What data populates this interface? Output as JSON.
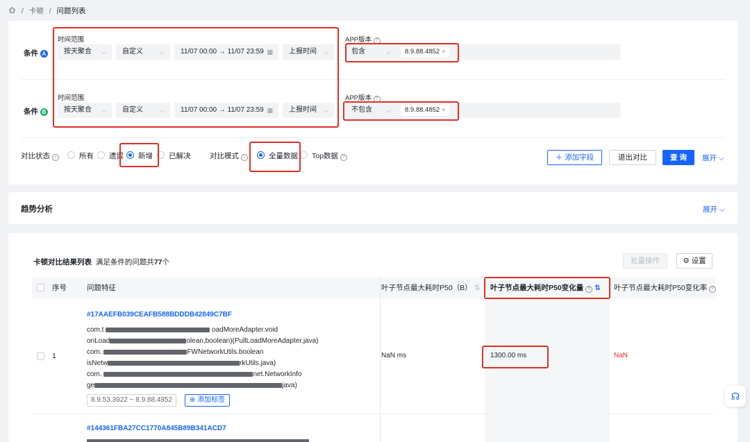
{
  "breadcrumb": {
    "items": [
      "卡顿",
      "问题列表"
    ]
  },
  "filter": {
    "condA": {
      "label": "条件",
      "badge": "A",
      "time_title": "时间范围",
      "agg": "按天聚合",
      "mode": "自定义",
      "range": "11/07 00:00 → 11/07 23:59",
      "report": "上报时间",
      "app_title": "APP版本",
      "op": "包含",
      "version_tag": "8.9.88.4852"
    },
    "condB": {
      "label": "条件",
      "badge": "B",
      "time_title": "时间范围",
      "agg": "按天聚合",
      "mode": "自定义",
      "range": "11/07 00:00 → 11/07 23:59",
      "report": "上报时间",
      "app_title": "APP版本",
      "op": "不包含",
      "version_tag": "8.9.88.4852"
    },
    "compare_status": {
      "label": "对比状态",
      "options": [
        "所有",
        "遗留",
        "新增",
        "已解决"
      ],
      "selected": "新增"
    },
    "compare_mode": {
      "label": "对比模式",
      "options": [
        "全量数据",
        "Top数据"
      ],
      "selected": "全量数据"
    },
    "add_field": "添加字段",
    "exit_compare": "退出对比",
    "query": "查 询",
    "expand": "展开"
  },
  "trend": {
    "title": "趋势分析",
    "expand": "展开"
  },
  "table": {
    "title": "卡顿对比结果列表",
    "summary_prefix": "满足条件的问题共",
    "summary_count": "77",
    "summary_suffix": "个",
    "batch": "批量操作",
    "settings": "设置",
    "columns": [
      "序号",
      "问题特征",
      "叶子节点最大耗时P50（B）",
      "叶子节点最大耗时P50变化量",
      "叶子节点最大耗时P50变化率"
    ],
    "rows": [
      {
        "index": "1",
        "issue_id": "#17AAEFB039CEAFB588BDDDB42849C7BF",
        "stack": [
          "com.t",
          "oadMoreAdapter.void",
          "onLoad",
          "olean,boolean)(PullLoadMoreAdapter.java)",
          "com.",
          "FWNetworkUtils.boolean",
          "isNetw",
          "rkUtils.java)",
          "com.",
          "net.NetworkInfo",
          "ge",
          "java)"
        ],
        "version_range": "8.9.53.3922 ~ 8.9.88.4852",
        "add_tag": "添加标签",
        "p50_b": "NaN ms",
        "p50_delta": "1300.00 ms",
        "p50_rate": "NaN"
      },
      {
        "issue_id": "#144361FBA27CC1770A845B89B341ACD7"
      }
    ]
  },
  "colors": {
    "accent": "#1664ff",
    "highlight": "#e02e24",
    "nan": "#e02e24",
    "badgeA": "#1664ff",
    "badgeB": "#17b26a"
  }
}
